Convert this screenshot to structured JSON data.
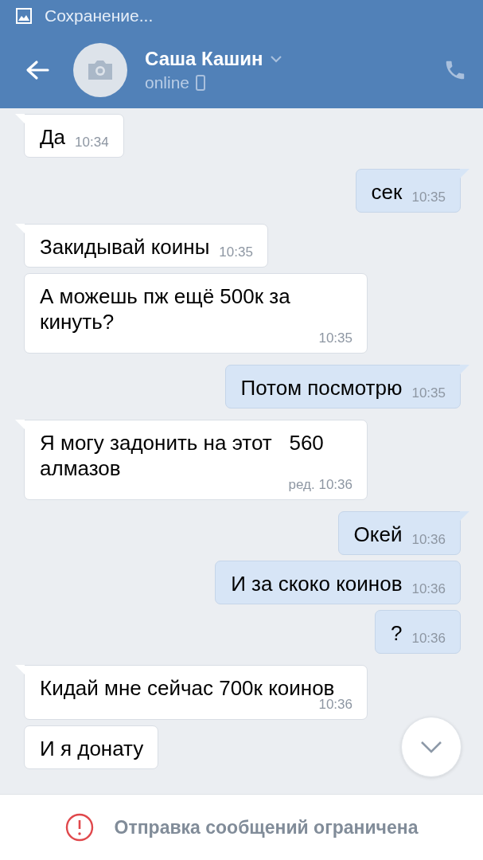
{
  "status_bar": {
    "text": "Сохранение..."
  },
  "header": {
    "name": "Саша Кашин",
    "status": "online"
  },
  "messages": [
    {
      "kind": "incoming",
      "text": "Да",
      "time": "10:34",
      "tail": true
    },
    {
      "kind": "outgoing",
      "text": "сек",
      "time": "10:35",
      "tail": true
    },
    {
      "kind": "incoming",
      "text": "Закидывай коины",
      "time": "10:35",
      "tail": true
    },
    {
      "kind": "incoming",
      "text": "А можешь пж ещё 500к за кинуть?",
      "time": "10:35",
      "tail": false
    },
    {
      "kind": "outgoing",
      "text": "Потом посмотрю",
      "time": "10:35",
      "tail": true
    },
    {
      "kind": "incoming",
      "text": "Я могу задонить на этот   560 алмазов",
      "time": "ред. 10:36",
      "tail": true
    },
    {
      "kind": "outgoing",
      "text": "Окей",
      "time": "10:36",
      "tail": true
    },
    {
      "kind": "outgoing",
      "text": "И за скоко коинов",
      "time": "10:36",
      "tail": false
    },
    {
      "kind": "outgoing",
      "text": "?",
      "time": "10:36",
      "tail": false
    },
    {
      "kind": "incoming",
      "text": "Кидай мне сейчас 700к коинов",
      "time": "10:36",
      "tail": true
    },
    {
      "kind": "incoming",
      "text": "И я донату",
      "tail": false
    }
  ],
  "notice": {
    "text": "Отправка сообщений ограничена"
  }
}
